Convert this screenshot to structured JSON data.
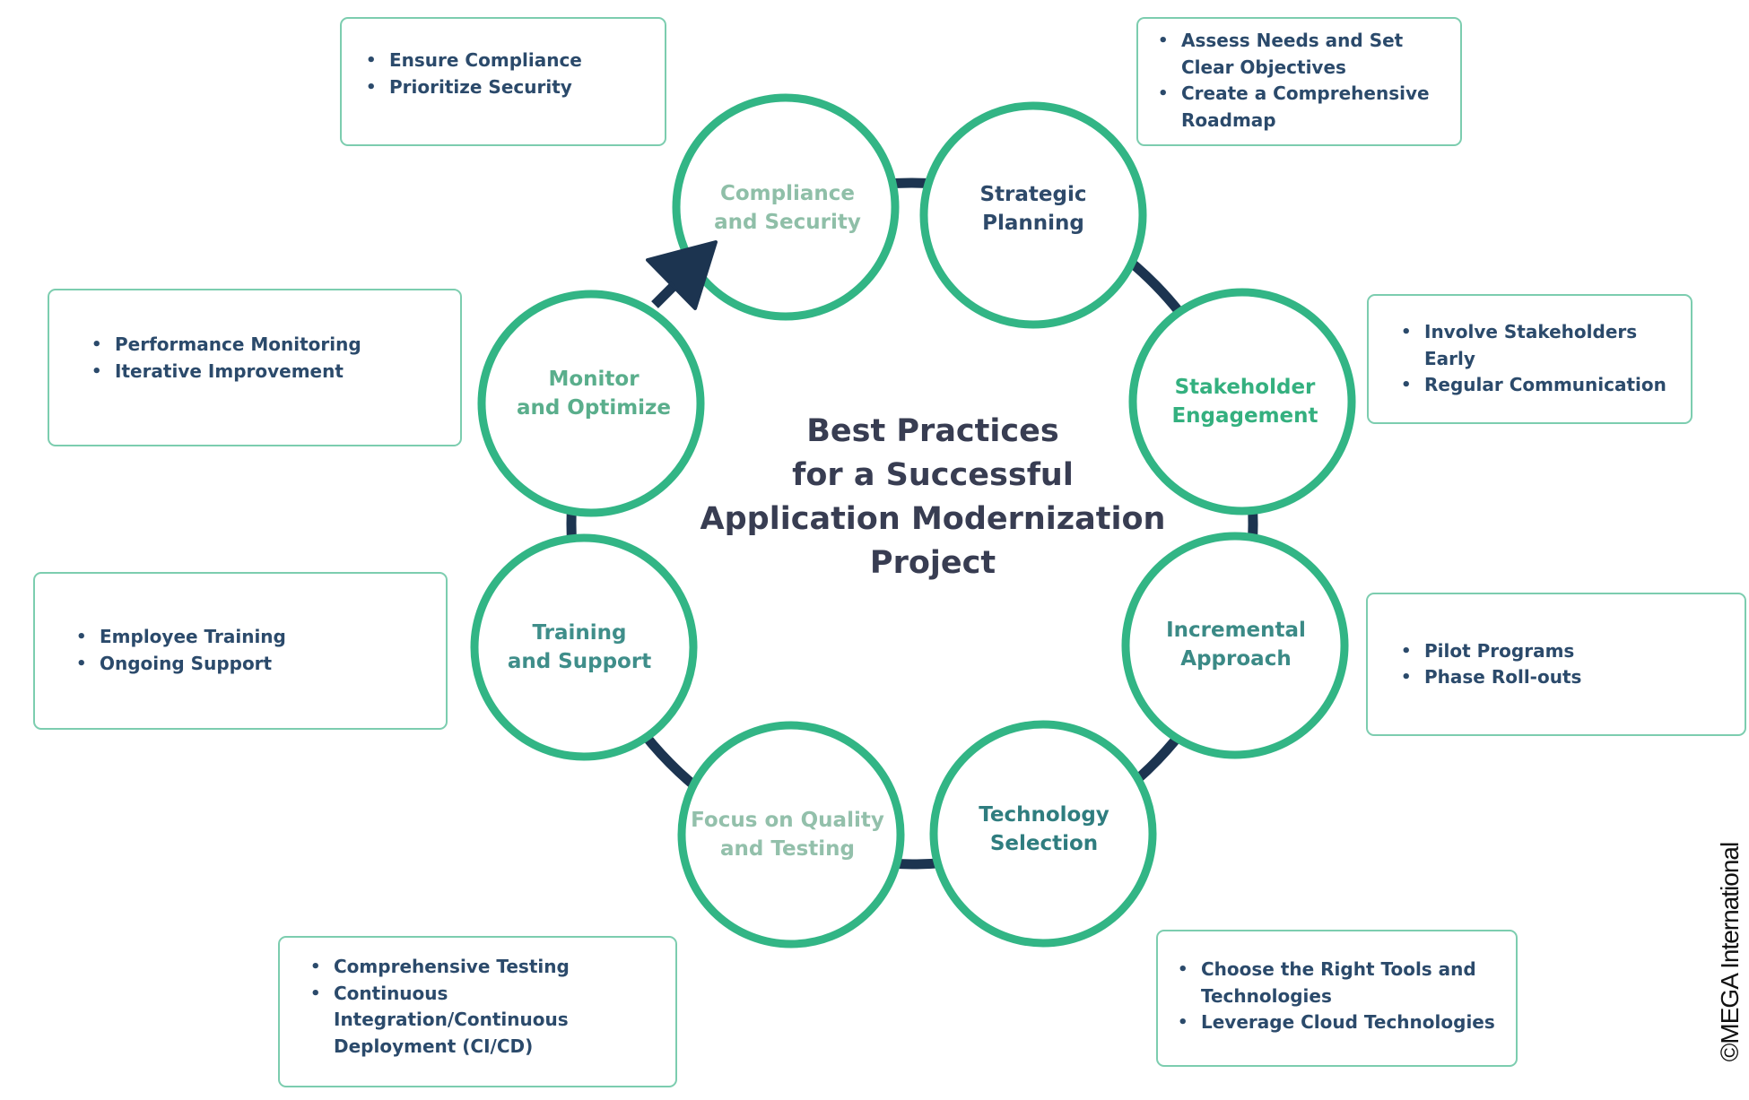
{
  "title": {
    "lines": [
      "Best Practices",
      "for a Successful",
      "Application Modernization",
      "Project"
    ]
  },
  "colors": {
    "ring": "#32b585",
    "connector": "#1c3450",
    "box_border": "#7ccdaf",
    "bullet_text": "#2b4a6b",
    "title_text": "#383d52"
  },
  "steps": [
    {
      "id": "compliance",
      "lines": [
        "Compliance",
        "and Security"
      ],
      "color": "#8fbfa8",
      "bullets": [
        "Ensure Compliance",
        "Prioritize Security"
      ]
    },
    {
      "id": "strategic",
      "lines": [
        "Strategic",
        "Planning"
      ],
      "color": "#2e4a6a",
      "bullets": [
        "Assess Needs and Set Clear Objectives",
        "Create a Comprehensive Roadmap"
      ]
    },
    {
      "id": "stakeholder",
      "lines": [
        "Stakeholder",
        "Engagement"
      ],
      "color": "#34b07f",
      "bullets": [
        "Involve Stakeholders Early",
        "Regular Communication"
      ]
    },
    {
      "id": "incremental",
      "lines": [
        "Incremental",
        "Approach"
      ],
      "color": "#3b8a86",
      "bullets": [
        "Pilot Programs",
        "Phase Roll-outs"
      ]
    },
    {
      "id": "technology",
      "lines": [
        "Technology",
        "Selection"
      ],
      "color": "#2f7d7f",
      "bullets": [
        "Choose the Right Tools and Technologies",
        "Leverage Cloud Technologies"
      ]
    },
    {
      "id": "quality",
      "lines": [
        "Focus on Quality",
        "and Testing"
      ],
      "color": "#93c0ab",
      "bullets": [
        "Comprehensive Testing",
        "Continuous Integration/Continuous Deployment (CI/CD)"
      ]
    },
    {
      "id": "training",
      "lines": [
        "Training",
        "and Support"
      ],
      "color": "#3f8e8a",
      "bullets": [
        "Employee Training",
        "Ongoing Support"
      ]
    },
    {
      "id": "monitor",
      "lines": [
        "Monitor",
        "and Optimize"
      ],
      "color": "#5aae8c",
      "bullets": [
        "Performance Monitoring",
        "Iterative Improvement"
      ]
    }
  ],
  "copyright": "©MEGA International"
}
